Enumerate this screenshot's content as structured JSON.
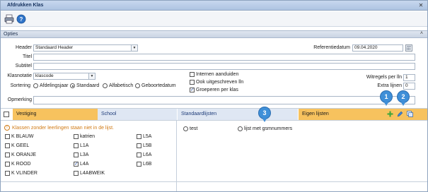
{
  "window": {
    "title": "Afdrukken Klas",
    "close_glyph": "✕"
  },
  "toolbar": {
    "print_icon": "printer-icon",
    "help_icon": "help-icon"
  },
  "opties": {
    "label": "Opties",
    "collapse_glyph": "˄"
  },
  "form": {
    "header_label": "Header",
    "header_value": "Standaard Header",
    "titel_label": "Titel",
    "subtitel_label": "Subtitel",
    "klasnotatie_label": "Klasnotatie",
    "klasnotatie_value": "klascode",
    "sortering_label": "Sortering",
    "sort_options": [
      "Afdelingsjaar",
      "Standaard",
      "Alfabetisch",
      "Geboortedatum"
    ],
    "sort_selected": "Standaard",
    "opmerking_label": "Opmerking",
    "referentiedatum_label": "Referentiedatum",
    "referentiedatum_value": "09.04.2020",
    "witregels_label": "Witregels per lln",
    "witregels_value": "1",
    "extra_lijnen_label": "Extra lijnen",
    "extra_lijnen_value": "0",
    "checkboxes": [
      {
        "label": "Internen aanduiden",
        "checked": false
      },
      {
        "label": "Ook uitgeschreven lln",
        "checked": false
      },
      {
        "label": "Groeperen per klas",
        "checked": true
      }
    ]
  },
  "tabs": {
    "vestiging": "Vestiging",
    "school": "School",
    "standaardlijsten": "Standaardlijsten",
    "eigen_lijsten": "Eigen lijsten"
  },
  "warning": {
    "text": "Klassen zonder leerlingen staan niet in de lijst."
  },
  "classes": {
    "col1": [
      {
        "label": "K BLAUW",
        "checked": false
      },
      {
        "label": "K GEEL",
        "checked": false
      },
      {
        "label": "K ORANJE",
        "checked": false
      },
      {
        "label": "K ROOD",
        "checked": false
      },
      {
        "label": "K VLINDER",
        "checked": false
      }
    ],
    "col2": [
      {
        "label": "katrien",
        "checked": false
      },
      {
        "label": "L1A",
        "checked": false
      },
      {
        "label": "L3A",
        "checked": false
      },
      {
        "label": "L4A",
        "checked": true
      },
      {
        "label": "L4ABWEIK",
        "checked": false
      }
    ],
    "col3": [
      {
        "label": "L5A",
        "checked": false
      },
      {
        "label": "L5B",
        "checked": false
      },
      {
        "label": "L6A",
        "checked": false
      },
      {
        "label": "L6B",
        "checked": false
      }
    ]
  },
  "standaard_lists": [
    "test",
    "lijst met gsmnummers"
  ],
  "callouts": [
    "1",
    "2",
    "3"
  ],
  "colors": {
    "accent_tab": "#f7c25e",
    "callout": "#3f8fd8",
    "warning": "#d07a15"
  }
}
